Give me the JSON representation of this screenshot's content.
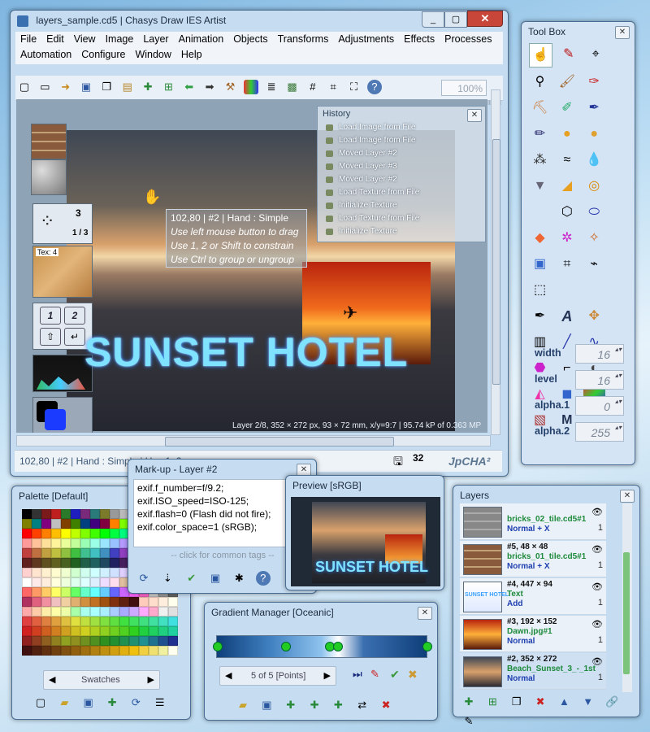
{
  "main_window": {
    "title": "layers_sample.cd5 | Chasys Draw IES Artist",
    "menu_row1": [
      "File",
      "Edit",
      "View",
      "Image",
      "Layer",
      "Animation",
      "Objects",
      "Transforms",
      "Adjustments",
      "Effects",
      "Processes"
    ],
    "menu_row2": [
      "Automation",
      "Configure",
      "Window",
      "Help"
    ],
    "zoom": "100%",
    "canvas": {
      "frame_counter": "3",
      "frame_fraction": "1 / 3",
      "texture_label": "Tex: 4",
      "key1": "1",
      "key2": "2",
      "canvas_status": "Layer 2/8, 352 × 272 px, 93 × 72 mm, x/y=9:7 | 95.74 kP of 0.363 MP",
      "sunset_text": "SUNSET HOTEL"
    },
    "tooltip": {
      "line0": "102,80 | #2 | Hand : Simple",
      "line1": "Use left mouse button to drag",
      "line2": "Use 1, 2 or Shift to constrain",
      "line3": "Use Ctrl to group or ungroup"
    },
    "history": {
      "title": "History",
      "items": [
        "Load Image from File",
        "Load Image from File",
        "Moved Layer #2",
        "Moved Layer #3",
        "Moved Layer #2",
        "Load Texture from File",
        "Initialize Texture",
        "Load Texture from File",
        "Initialize Texture"
      ]
    },
    "statusbar": {
      "text": "102,80 | #2 | Hand : Simple | Use 1, 2 o...",
      "num": "32",
      "brand": "JpCHA²"
    }
  },
  "toolbox": {
    "title": "Tool Box",
    "fields": [
      {
        "label": "width",
        "value": "16"
      },
      {
        "label": "level",
        "value": "16"
      },
      {
        "label": "alpha.1",
        "value": "0"
      },
      {
        "label": "alpha.2",
        "value": "255"
      }
    ]
  },
  "palette": {
    "title": "Palette [Default]",
    "nav_label": "Swatches"
  },
  "markup": {
    "title": "Mark-up - Layer #2",
    "lines": [
      "exif.f_number=f/9.2;",
      "exif.ISO_speed=ISO-125;",
      "exif.flash=0 (Flash did not fire);",
      "exif.color_space=1 (sRGB);"
    ],
    "hint": "-- click for common tags --"
  },
  "preview": {
    "title": "Preview [sRGB]",
    "sunset_text": "SUNSET HOTEL"
  },
  "gradient": {
    "title": "Gradient Manager [Oceanic]",
    "nav_label": "5 of 5 [Points]"
  },
  "layers": {
    "title": "Layers",
    "items": [
      {
        "name": "",
        "file": "bricks_02_tile.cd5#1",
        "mode": "Normal + X",
        "count": "1"
      },
      {
        "name": "#5, 48 × 48",
        "file": "bricks_01_tile.cd5#1",
        "mode": "Normal + X",
        "count": "1"
      },
      {
        "name": "#4, 447 × 94",
        "file": "Text",
        "mode": "Add",
        "count": "1"
      },
      {
        "name": "#3, 192 × 152",
        "file": "Dawn.jpg#1",
        "mode": "Normal",
        "count": "1"
      },
      {
        "name": "#2, 352 × 272",
        "file": "Beach_Sunset_3_-_1st",
        "mode": "Normal",
        "count": "1"
      }
    ]
  }
}
